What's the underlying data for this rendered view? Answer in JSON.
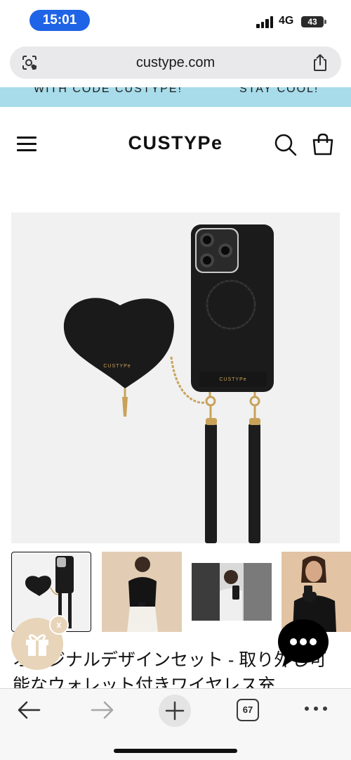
{
  "status_bar": {
    "time": "15:01",
    "network": "4G",
    "battery": "43"
  },
  "browser": {
    "url": "custype.com",
    "tab_count": "67"
  },
  "announcement": {
    "left_text": "WITH CODE CUSTYPE!",
    "right_text": "STAY COOL!"
  },
  "header": {
    "logo": "CUSTYPe"
  },
  "product": {
    "image_brand_mark": "CUSTYPe",
    "thumbnails": [
      {
        "kind": "product-photo",
        "selected": true
      },
      {
        "kind": "model-photo",
        "selected": false
      },
      {
        "kind": "model-photo",
        "selected": false
      },
      {
        "kind": "model-photo",
        "selected": false
      }
    ],
    "title": "オリジナルデザインセット - 取り外し可能なウォレット付きワイヤレス充"
  },
  "widgets": {
    "gift_close": "x"
  },
  "colors": {
    "time_pill": "#1f63e6",
    "announcement_bg": "#a8dcea",
    "gift_bg": "#e8d4b8",
    "product_black": "#1b1b1b",
    "gold": "#c9a25a"
  },
  "icons": [
    "signal-icon",
    "battery-icon",
    "site-settings-icon",
    "share-icon",
    "menu-icon",
    "search-icon",
    "cart-icon",
    "gift-icon",
    "chat-icon",
    "back-arrow-icon",
    "forward-arrow-icon",
    "plus-icon",
    "tabs-icon",
    "more-icon"
  ]
}
